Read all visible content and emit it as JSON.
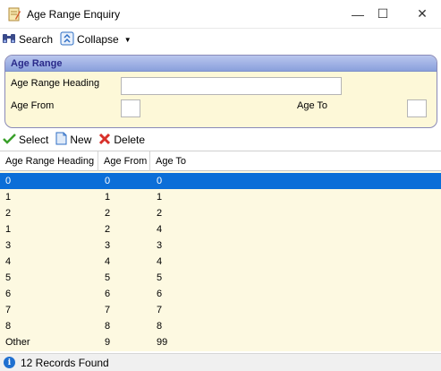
{
  "window": {
    "title": "Age Range Enquiry",
    "minimize": "—",
    "maximize": "☐",
    "close": "✕"
  },
  "toolbar": {
    "search_label": "Search",
    "collapse_label": "Collapse"
  },
  "criteria": {
    "group_title": "Age Range",
    "heading_label": "Age Range Heading",
    "heading_value": "",
    "age_from_label": "Age From",
    "age_from_value": "",
    "age_to_label": "Age To",
    "age_to_value": ""
  },
  "actions": {
    "select_label": "Select",
    "new_label": "New",
    "delete_label": "Delete"
  },
  "grid": {
    "columns": [
      "Age Range Heading",
      "Age From",
      "Age To"
    ],
    "selected_index": 0,
    "rows": [
      [
        "0",
        "0",
        "0"
      ],
      [
        "1",
        "1",
        "1"
      ],
      [
        "2",
        "2",
        "2"
      ],
      [
        "1",
        "2",
        "4"
      ],
      [
        "3",
        "3",
        "3"
      ],
      [
        "4",
        "4",
        "4"
      ],
      [
        "5",
        "5",
        "5"
      ],
      [
        "6",
        "6",
        "6"
      ],
      [
        "7",
        "7",
        "7"
      ],
      [
        "8",
        "8",
        "8"
      ],
      [
        "Other",
        "9",
        "99"
      ]
    ]
  },
  "status": {
    "text": "12 Records Found"
  },
  "colors": {
    "selection": "#0b6ed8",
    "grid_background": "#fdf9e1",
    "group_header": "#8aa0dc",
    "group_title_text": "#2a2a8a"
  }
}
